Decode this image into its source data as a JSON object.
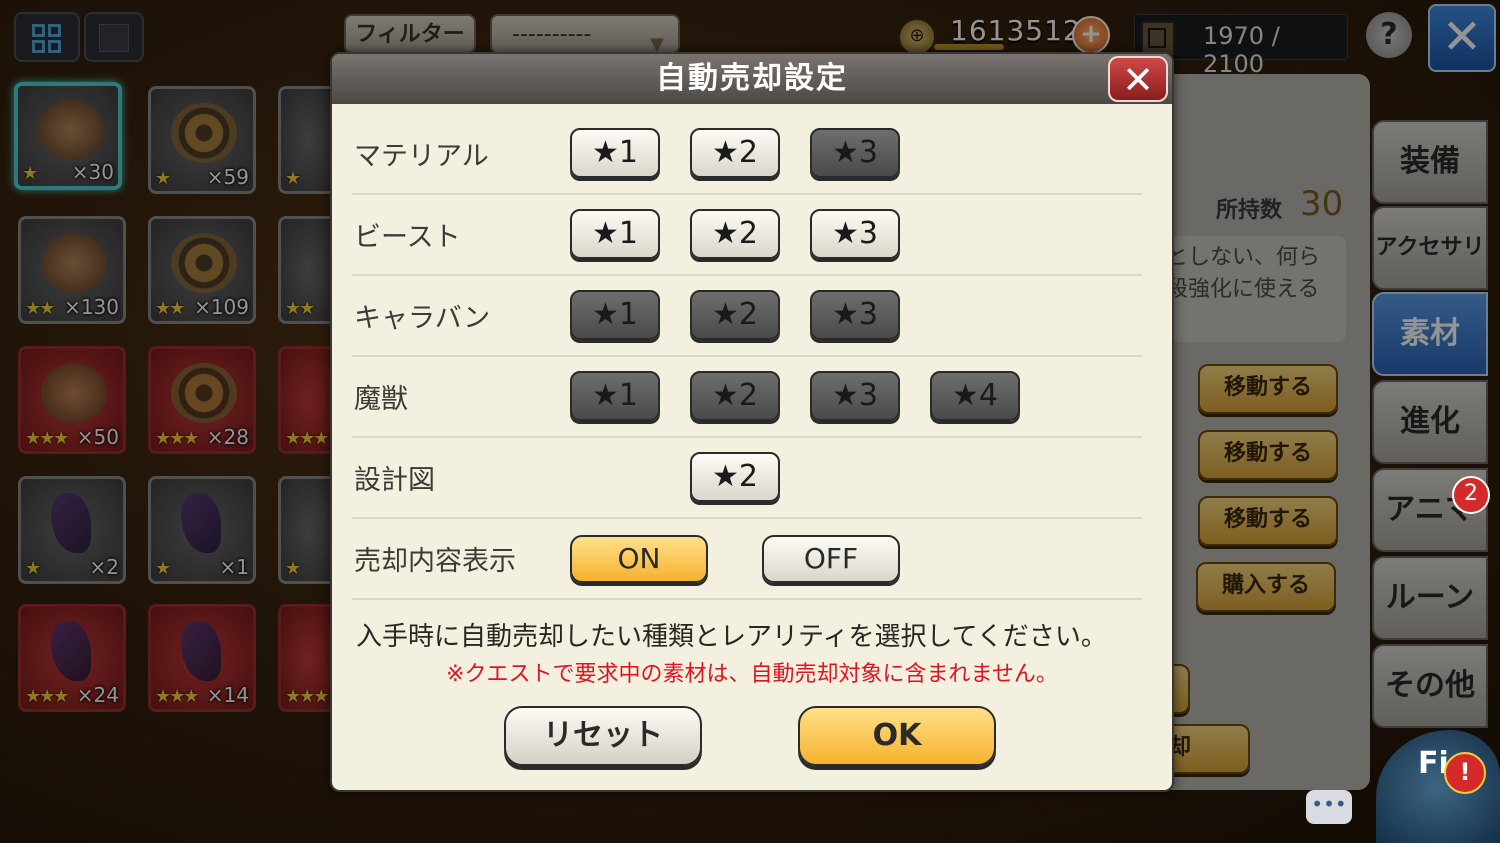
{
  "topbar": {
    "filter_label": "フィルター",
    "filter_value": "----------",
    "coins": "1613512",
    "capacity": "1970 / 2100",
    "help_label": "?",
    "close_label": "✕"
  },
  "inventory": [
    {
      "stars": "★",
      "qty": "×30"
    },
    {
      "stars": "★",
      "qty": "×59"
    },
    {
      "stars": "★",
      "qty": ""
    },
    {
      "stars": "★★",
      "qty": "×130"
    },
    {
      "stars": "★★",
      "qty": "×109"
    },
    {
      "stars": "★★",
      "qty": ""
    },
    {
      "stars": "★★★",
      "qty": "×50"
    },
    {
      "stars": "★★★",
      "qty": "×28"
    },
    {
      "stars": "★★★",
      "qty": ""
    },
    {
      "stars": "★",
      "qty": "×2"
    },
    {
      "stars": "★",
      "qty": "×1"
    },
    {
      "stars": "★",
      "qty": ""
    },
    {
      "stars": "★★★",
      "qty": "×24"
    },
    {
      "stars": "★★★",
      "qty": "×14"
    },
    {
      "stars": "★★★",
      "qty": ""
    }
  ],
  "detail": {
    "owned_label": "所持数",
    "owned_value": "30",
    "description": "としない、何ら\n殺強化に使える",
    "buttons": [
      "移動する",
      "移動する",
      "移動する",
      "購入する"
    ],
    "partial_button": "却"
  },
  "side_tabs": [
    "装備",
    "アクセサリ",
    "素材",
    "進化",
    "アニマ",
    "ルーン",
    "その他"
  ],
  "side_badge": "2",
  "mascot": {
    "text": "Fi",
    "alert": "!"
  },
  "chat_icon": "•••",
  "modal": {
    "title": "自動売却設定",
    "close": "✕",
    "rows": [
      {
        "label": "マテリアル",
        "buttons": [
          "★1",
          "★2",
          "★3"
        ]
      },
      {
        "label": "ビースト",
        "buttons": [
          "★1",
          "★2",
          "★3"
        ]
      },
      {
        "label": "キャラバン",
        "buttons": [
          "★1",
          "★2",
          "★3"
        ]
      },
      {
        "label": "魔獣",
        "buttons": [
          "★1",
          "★2",
          "★3",
          "★4"
        ]
      },
      {
        "label": "設計図",
        "buttons": [
          "★2"
        ]
      }
    ],
    "display_label": "売却内容表示",
    "on_label": "ON",
    "off_label": "OFF",
    "instruction": "入手時に自動売却したい種類とレアリティを選択してください。",
    "note": "※クエストで要求中の素材は、自動売却対象に含まれません。",
    "reset_label": "リセット",
    "ok_label": "OK"
  },
  "colors": {
    "selected_star_bg": "#f4f0e0",
    "unselected_star_bg": "#5a5a5a",
    "accent_yellow": "#f6b22e",
    "note_red": "#e0141e",
    "active_tab_blue": "#2a64b8"
  }
}
